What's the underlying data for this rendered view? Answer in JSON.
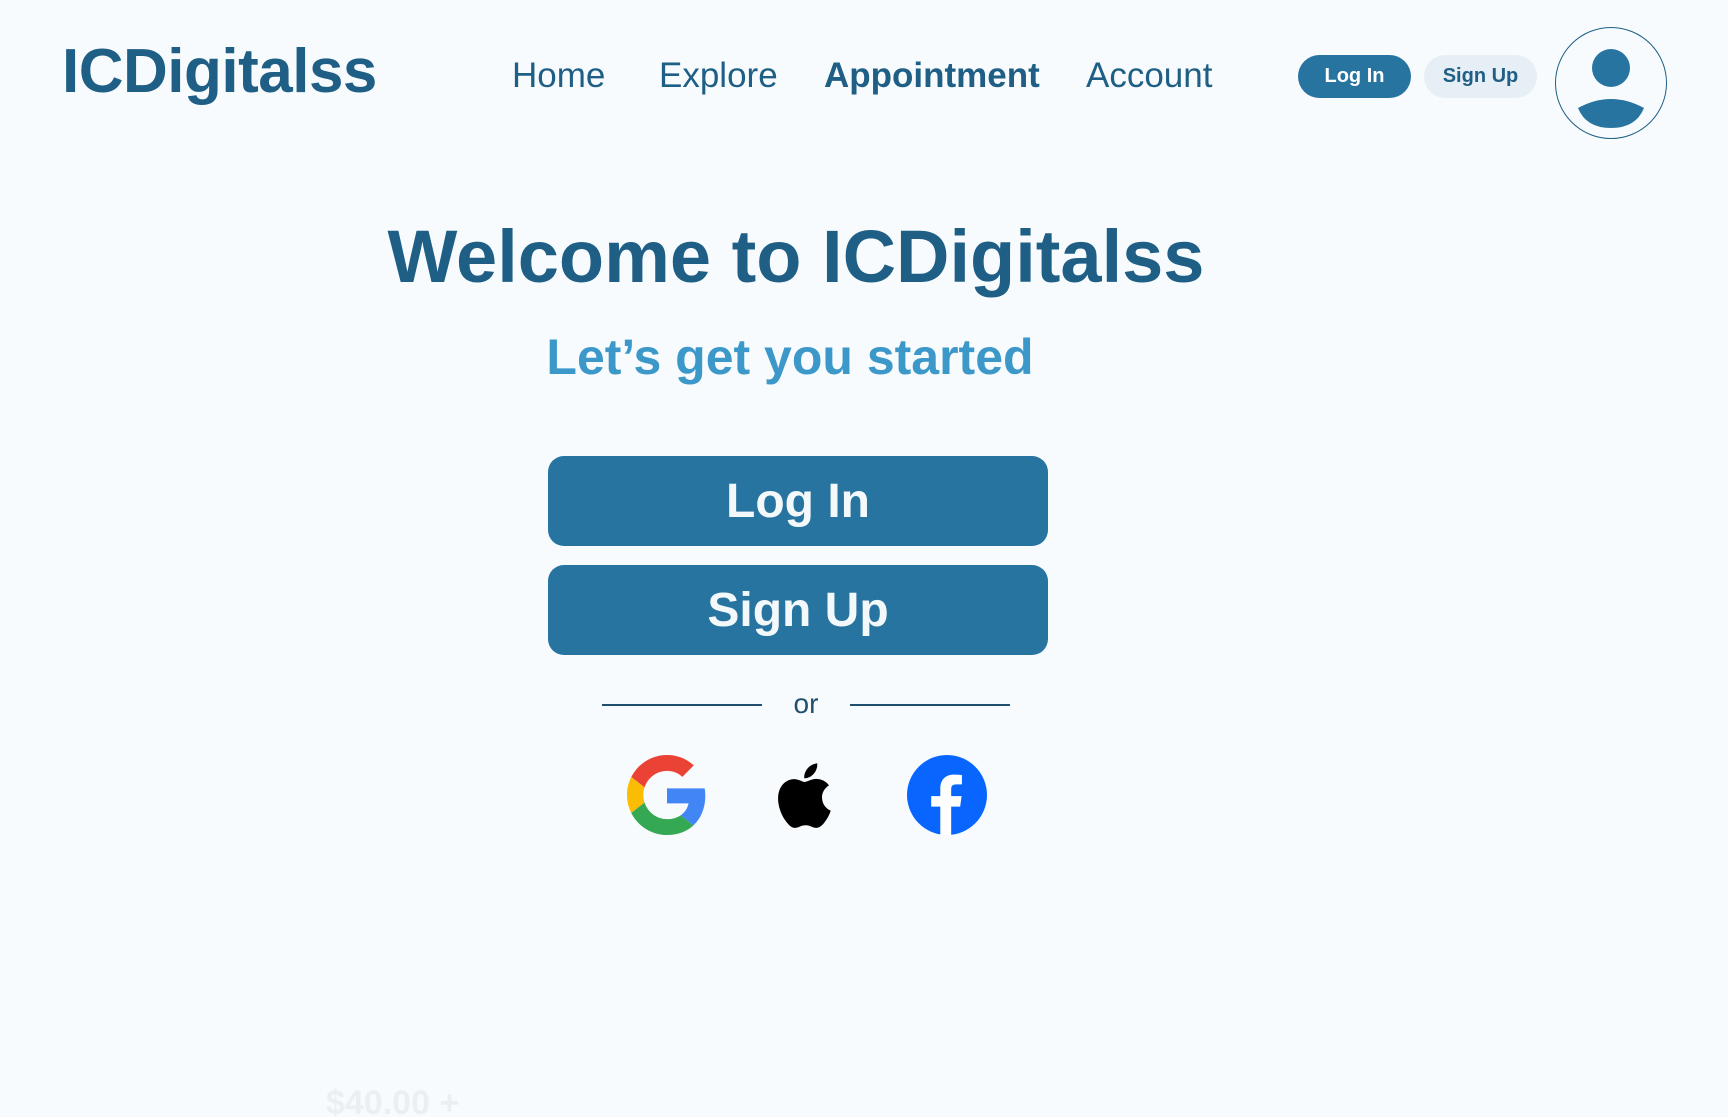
{
  "header": {
    "logo": "ICDigitalss",
    "nav": [
      {
        "label": "Home",
        "active": false
      },
      {
        "label": "Explore",
        "active": false
      },
      {
        "label": "Appointment",
        "active": true
      },
      {
        "label": "Account",
        "active": false
      }
    ],
    "login_label": "Log In",
    "signup_label": "Sign Up",
    "avatar_icon": "user-avatar-icon"
  },
  "main": {
    "title": "Welcome to ICDigitalss",
    "subtitle": "Let’s get you started",
    "login_label": "Log In",
    "signup_label": "Sign Up",
    "divider_text": "or",
    "social": [
      {
        "name": "google-icon"
      },
      {
        "name": "apple-icon"
      },
      {
        "name": "facebook-icon"
      }
    ],
    "ghost_text": "$40.00 +"
  },
  "colors": {
    "primary": "#2874a1",
    "brand_text": "#1f5f86",
    "accent": "#3b98c9",
    "background": "#f7fbfd",
    "secondary_button": "#e6eff5"
  }
}
